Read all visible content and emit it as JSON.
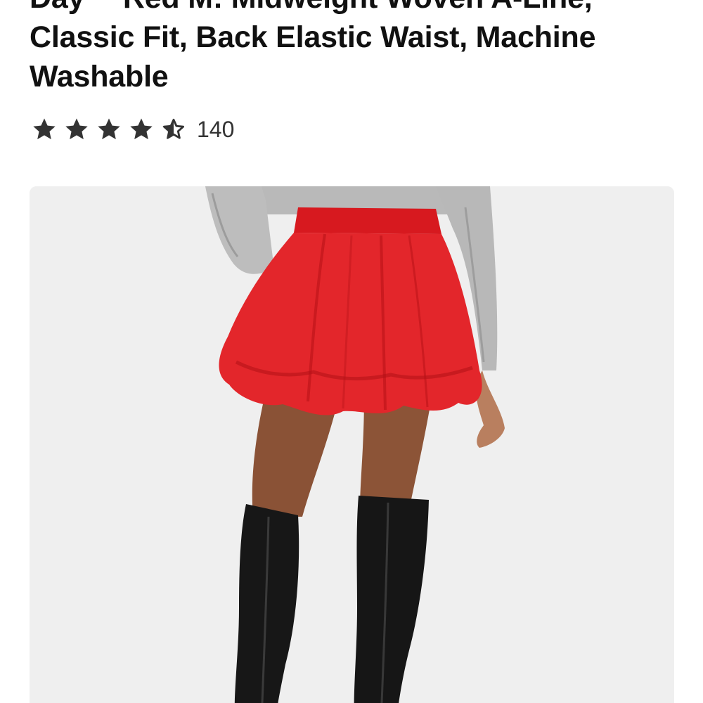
{
  "product": {
    "title_lines": [
      "Day™ Red M: Midweight Woven A-Line,",
      "Classic Fit, Back Elastic Waist, Machine",
      "Washable"
    ],
    "rating": {
      "value": 4.5,
      "max": 5,
      "count": "140",
      "star_color": "#333333"
    },
    "image": {
      "subject_icon": "product-photo-red-bubble-skirt",
      "background_color": "#efefef",
      "skirt_color": "#e3262b",
      "sweater_color": "#b9b9b9",
      "boot_color": "#171717"
    }
  }
}
